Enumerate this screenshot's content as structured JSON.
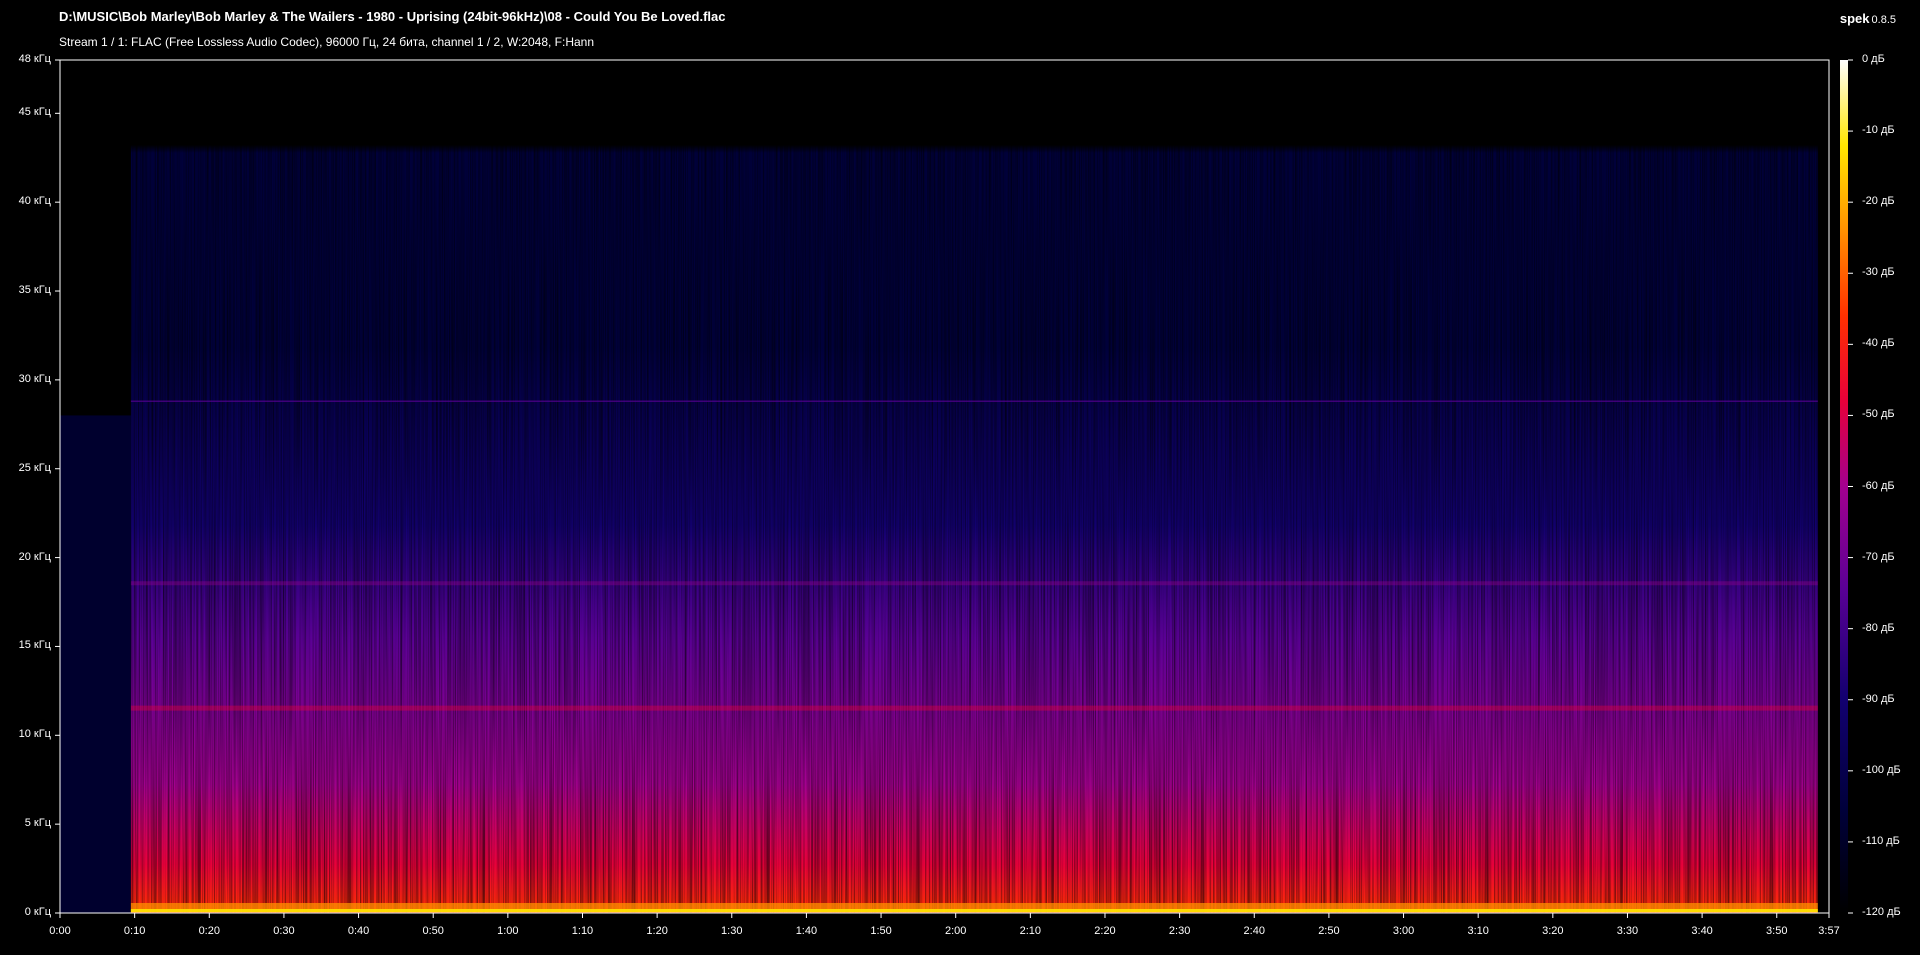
{
  "header": {
    "file_title": "D:\\MUSIC\\Bob Marley\\Bob Marley & The Wailers - 1980 - Uprising (24bit-96kHz)\\08 - Could You Be Loved.flac",
    "stream_info": "Stream 1 / 1: FLAC (Free Lossless Audio Codec), 96000 Гц, 24 бита, channel 1 / 2, W:2048, F:Hann",
    "app_name": "spek",
    "app_version": "0.8.5"
  },
  "colors": {
    "background": "#000000",
    "axis": "#ffffff",
    "palette": [
      "#000000",
      "#00003a",
      "#120070",
      "#5a0095",
      "#a3008f",
      "#e8003a",
      "#ff3000",
      "#ff9000",
      "#ffe600",
      "#ffffff"
    ]
  },
  "chart_data": {
    "type": "heatmap",
    "x_axis": {
      "label": "",
      "min_seconds": 0,
      "max_seconds": 237,
      "ticks": [
        {
          "seconds": 0,
          "label": "0:00"
        },
        {
          "seconds": 10,
          "label": "0:10"
        },
        {
          "seconds": 20,
          "label": "0:20"
        },
        {
          "seconds": 30,
          "label": "0:30"
        },
        {
          "seconds": 40,
          "label": "0:40"
        },
        {
          "seconds": 50,
          "label": "0:50"
        },
        {
          "seconds": 60,
          "label": "1:00"
        },
        {
          "seconds": 70,
          "label": "1:10"
        },
        {
          "seconds": 80,
          "label": "1:20"
        },
        {
          "seconds": 90,
          "label": "1:30"
        },
        {
          "seconds": 100,
          "label": "1:40"
        },
        {
          "seconds": 110,
          "label": "1:50"
        },
        {
          "seconds": 120,
          "label": "2:00"
        },
        {
          "seconds": 130,
          "label": "2:10"
        },
        {
          "seconds": 140,
          "label": "2:20"
        },
        {
          "seconds": 150,
          "label": "2:30"
        },
        {
          "seconds": 160,
          "label": "2:40"
        },
        {
          "seconds": 170,
          "label": "2:50"
        },
        {
          "seconds": 180,
          "label": "3:00"
        },
        {
          "seconds": 190,
          "label": "3:10"
        },
        {
          "seconds": 200,
          "label": "3:20"
        },
        {
          "seconds": 210,
          "label": "3:30"
        },
        {
          "seconds": 220,
          "label": "3:40"
        },
        {
          "seconds": 230,
          "label": "3:50"
        },
        {
          "seconds": 237,
          "label": "3:57"
        }
      ]
    },
    "y_axis": {
      "label": "",
      "min_khz": 0,
      "max_khz": 48,
      "ticks": [
        {
          "khz": 0,
          "label": "0 кГц"
        },
        {
          "khz": 5,
          "label": "5 кГц"
        },
        {
          "khz": 10,
          "label": "10 кГц"
        },
        {
          "khz": 15,
          "label": "15 кГц"
        },
        {
          "khz": 20,
          "label": "20 кГц"
        },
        {
          "khz": 25,
          "label": "25 кГц"
        },
        {
          "khz": 30,
          "label": "30 кГц"
        },
        {
          "khz": 35,
          "label": "35 кГц"
        },
        {
          "khz": 40,
          "label": "40 кГц"
        },
        {
          "khz": 45,
          "label": "45 кГц"
        },
        {
          "khz": 48,
          "label": "48 кГц"
        }
      ]
    },
    "color_scale": {
      "min_db": -120,
      "max_db": 0,
      "ticks": [
        {
          "db": 0,
          "label": "0 дБ"
        },
        {
          "db": -10,
          "label": "-10 дБ"
        },
        {
          "db": -20,
          "label": "-20 дБ"
        },
        {
          "db": -30,
          "label": "-30 дБ"
        },
        {
          "db": -40,
          "label": "-40 дБ"
        },
        {
          "db": -50,
          "label": "-50 дБ"
        },
        {
          "db": -60,
          "label": "-60 дБ"
        },
        {
          "db": -70,
          "label": "-70 дБ"
        },
        {
          "db": -80,
          "label": "-80 дБ"
        },
        {
          "db": -90,
          "label": "-90 дБ"
        },
        {
          "db": -100,
          "label": "-100 дБ"
        },
        {
          "db": -110,
          "label": "-110 дБ"
        },
        {
          "db": -120,
          "label": "-120 дБ"
        }
      ]
    },
    "features": {
      "music_start_seconds": 9.5,
      "music_end_seconds": 235.5,
      "upper_content_cutoff_khz": 45.5,
      "horizontal_line_khz": 28.8,
      "band_khz": [
        11.5,
        18.5
      ]
    }
  }
}
